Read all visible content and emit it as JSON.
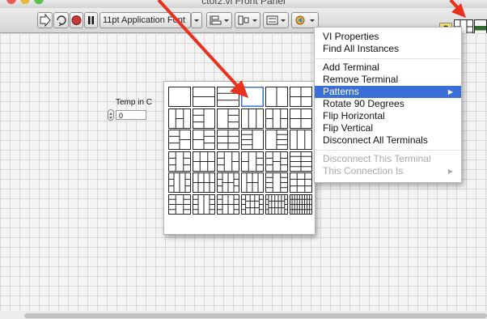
{
  "window": {
    "title": "ctof2.vi Front Panel"
  },
  "toolbar": {
    "font_selector": "11pt Application Font",
    "help": "?",
    "icons": [
      "run-arrow-icon",
      "run-continuously-icon",
      "abort-icon",
      "pause-icon",
      "align-objects-icon",
      "distribute-objects-icon",
      "resize-objects-icon",
      "reorder-icon"
    ]
  },
  "control": {
    "label": "Temp in C",
    "value": "0"
  },
  "context_menu": {
    "items": [
      {
        "label": "VI Properties",
        "state": "normal"
      },
      {
        "label": "Find All Instances",
        "state": "normal"
      },
      {
        "label": "Add Terminal",
        "state": "normal"
      },
      {
        "label": "Remove Terminal",
        "state": "normal"
      },
      {
        "label": "Patterns",
        "state": "highlighted",
        "submenu": true
      },
      {
        "label": "Rotate 90 Degrees",
        "state": "normal"
      },
      {
        "label": "Flip Horizontal",
        "state": "normal"
      },
      {
        "label": "Flip Vertical",
        "state": "normal"
      },
      {
        "label": "Disconnect All Terminals",
        "state": "normal"
      },
      {
        "label": "Disconnect This Terminal",
        "state": "disabled"
      },
      {
        "label": "This Connection Is",
        "state": "disabled",
        "submenu": true
      }
    ]
  },
  "patterns_palette": {
    "rows": 6,
    "columns": 6,
    "selected": "row 1, column 4"
  },
  "colors": {
    "menu_highlight": "#3a6fd8",
    "annotation_arrow": "#e8321e",
    "disabled_text": "#a9a9a9"
  }
}
